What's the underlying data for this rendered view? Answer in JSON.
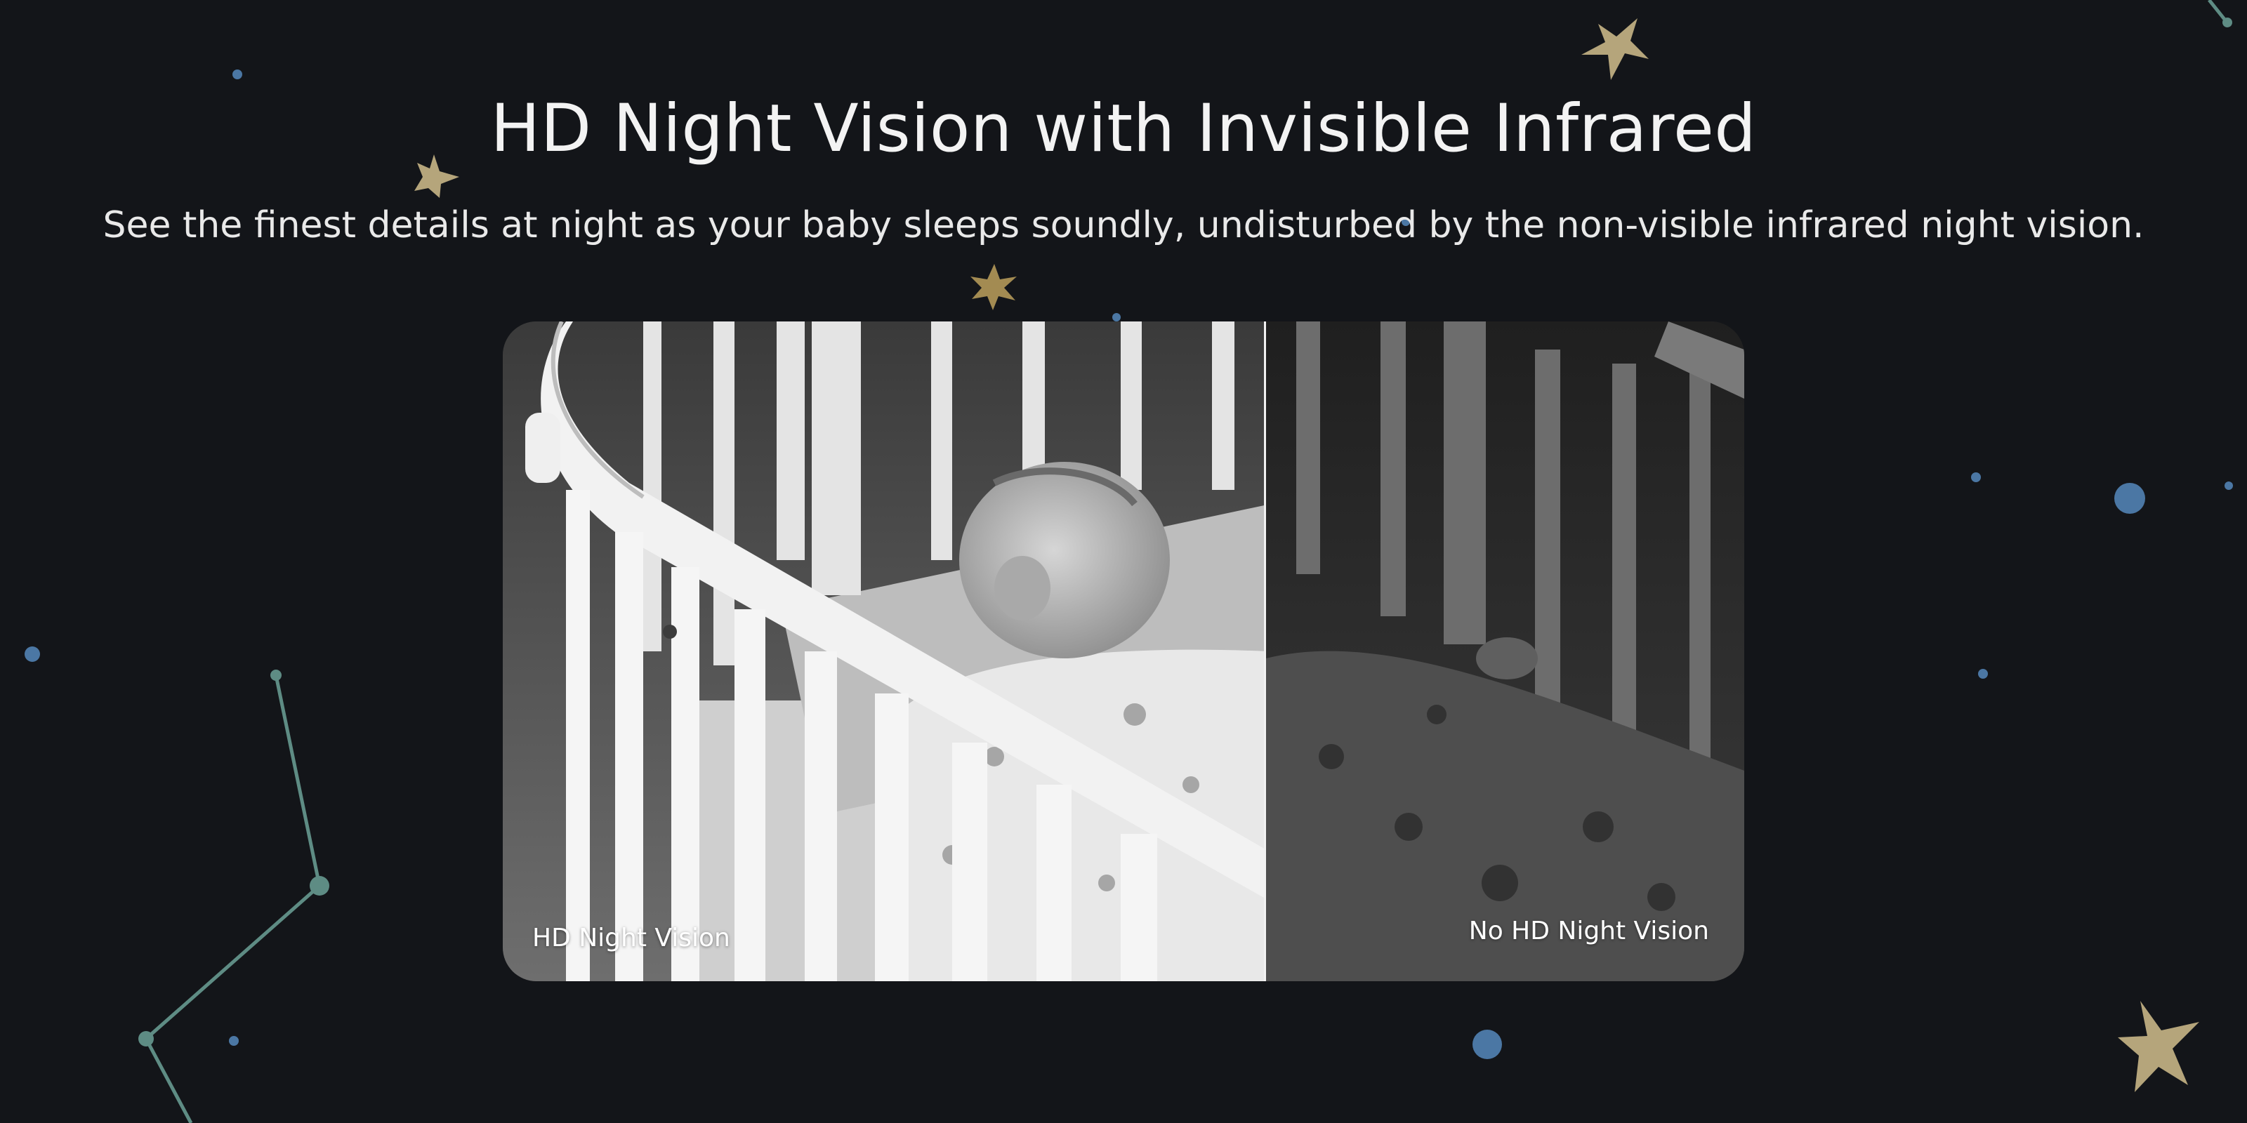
{
  "section": {
    "title": "HD Night Vision with Invisible Infrared",
    "subtitle": "See the finest details at night as your baby sleeps soundly, undisturbed by the non-visible infrared night vision."
  },
  "comparison": {
    "left_label": "HD Night Vision",
    "right_label": "No HD Night Vision"
  },
  "colors": {
    "background": "#131519",
    "star_gold": "#b5a57b",
    "star_deep_gold": "#a38b52",
    "dot_blue": "#4b77a4",
    "constellation_teal": "#5e8c84"
  }
}
